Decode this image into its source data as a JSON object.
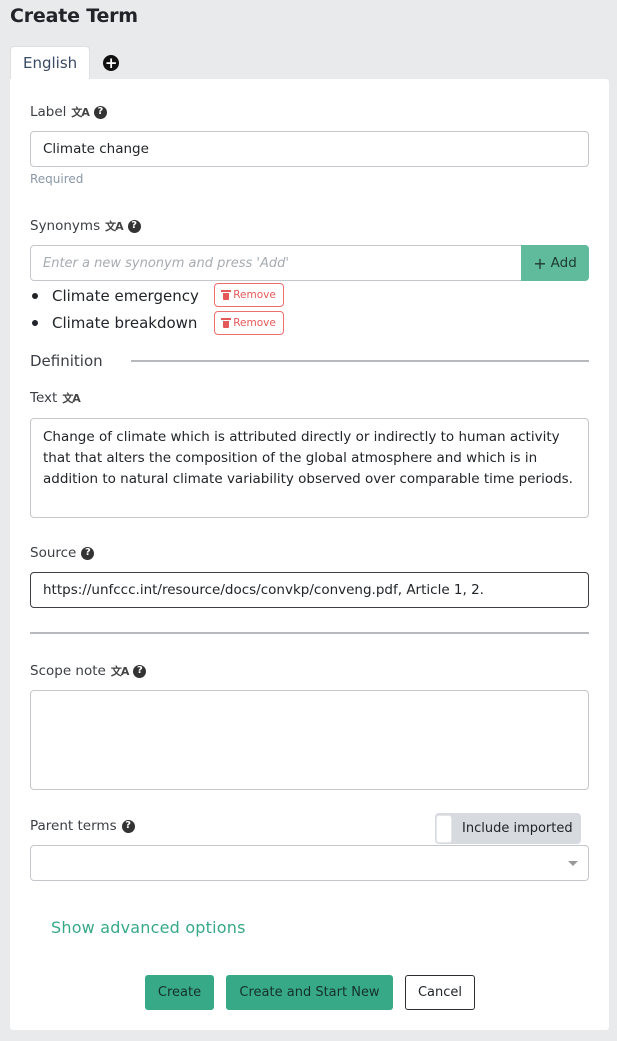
{
  "page": {
    "title": "Create Term"
  },
  "tabs": [
    {
      "label": "English",
      "active": true
    }
  ],
  "add_language_icon": "plus-circle-icon",
  "label_field": {
    "label": "Label",
    "translate_icon": "translate-icon",
    "help_icon": "question-circle-icon",
    "value": "Climate change",
    "help_text": "Required"
  },
  "synonyms": {
    "label": "Synonyms",
    "placeholder": "Enter a new synonym and press 'Add'",
    "add_label": "Add",
    "items": [
      {
        "text": "Climate emergency",
        "remove_label": "Remove"
      },
      {
        "text": "Climate breakdown",
        "remove_label": "Remove"
      }
    ]
  },
  "definition": {
    "section_title": "Definition",
    "text_label": "Text",
    "text_value": "Change of climate which is attributed directly or indirectly to human activity that that alters the composition of the global atmosphere and which is in addition to natural climate variability observed over comparable time periods.",
    "source_label": "Source",
    "source_value": "https://unfccc.int/resource/docs/convkp/conveng.pdf, Article 1, 2."
  },
  "scope_note": {
    "label": "Scope note",
    "value": ""
  },
  "parent_terms": {
    "label": "Parent terms",
    "include_imported_label": "Include imported",
    "include_imported": false,
    "value": ""
  },
  "advanced_link": "Show advanced options",
  "actions": {
    "create": "Create",
    "create_and_new": "Create and Start New",
    "cancel": "Cancel"
  },
  "colors": {
    "primary": "#37a987",
    "add_button": "#5fbb9b",
    "danger": "#e45858",
    "background": "#e9eaec"
  }
}
